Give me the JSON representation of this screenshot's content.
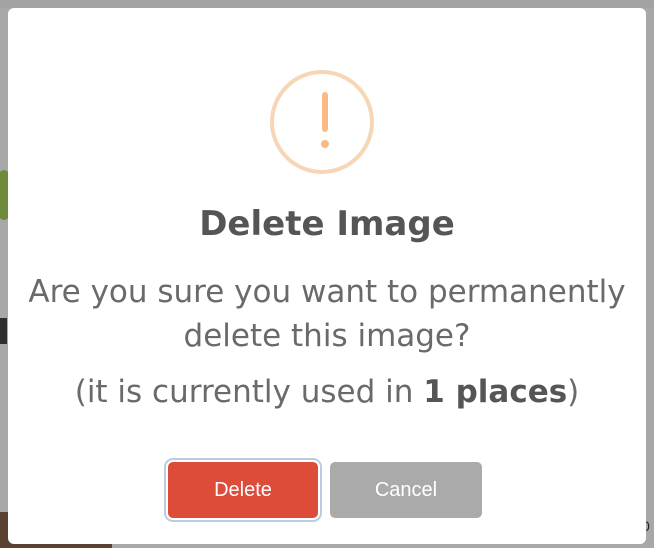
{
  "dialog": {
    "icon": "warning-exclamation-icon",
    "title": "Delete Image",
    "message": "Are you sure you want to permanently delete this image?",
    "usage_prefix": "(it is currently used in ",
    "usage_count_text": "1 places",
    "usage_suffix": ")",
    "confirm_label": "Delete",
    "cancel_label": "Cancel"
  },
  "background": {
    "corner_text": "0"
  },
  "colors": {
    "warning": "#f8bb86",
    "warning_ring": "#f6d6b5",
    "danger": "#dd4b39",
    "neutral": "#aaaaaa",
    "overlay": "#a8a8a8"
  }
}
